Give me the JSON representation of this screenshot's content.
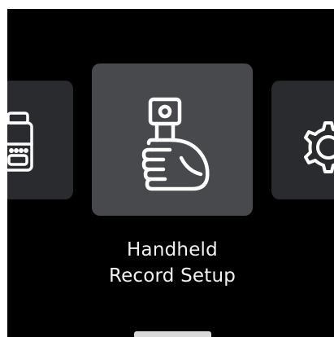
{
  "menu": {
    "items": [
      {
        "icon": "battery-pack-icon",
        "label": ""
      },
      {
        "icon": "handheld-grip-icon",
        "label_line1": "Handheld",
        "label_line2": "Record Setup"
      },
      {
        "icon": "gear-icon",
        "label": ""
      }
    ],
    "selected_index": 1
  },
  "colors": {
    "background": "#000000",
    "tile_selected": "#48494d",
    "tile_unselected": "#2a2b2e",
    "icon_stroke": "#ffffff",
    "text": "#f2f2f2",
    "indicator": "#d9d9d9"
  }
}
